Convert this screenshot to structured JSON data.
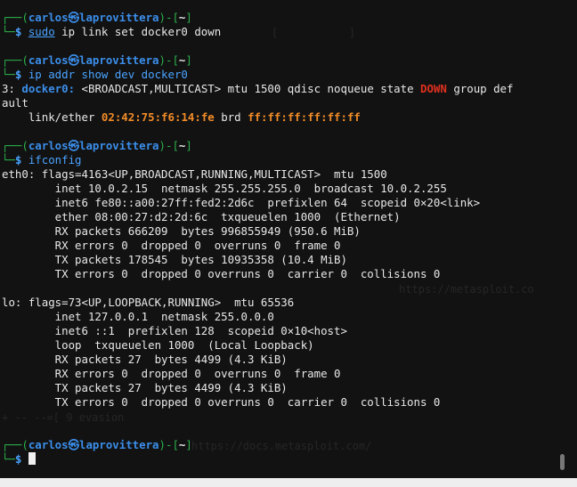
{
  "prompt": {
    "user": "carlos",
    "at": "㉿",
    "host": "laprovittera",
    "dir": "~"
  },
  "blocks": [
    {
      "command": "sudo ip link set docker0 down",
      "cmd_word": "sudo",
      "rest": "ip link set docker0 down"
    },
    {
      "command": "ip addr show dev docker0"
    },
    {
      "command": "ifconfig"
    }
  ],
  "ip_output": {
    "idx": "3:",
    "iface": "docker0:",
    "flags": "<BROADCAST,MULTICAST> mtu 1500 qdisc noqueue state",
    "state": "DOWN",
    "after_state": "group def",
    "wrap": "ault",
    "link_prefix": "link/ether",
    "mac": "02:42:75:f6:14:fe",
    "brd": "brd",
    "brd_mac": "ff:ff:ff:ff:ff:ff"
  },
  "ifconfig_lines": [
    "eth0: flags=4163<UP,BROADCAST,RUNNING,MULTICAST>  mtu 1500",
    "        inet 10.0.2.15  netmask 255.255.255.0  broadcast 10.0.2.255",
    "        inet6 fe80::a00:27ff:fed2:2d6c  prefixlen 64  scopeid 0×20<link>",
    "        ether 08:00:27:d2:2d:6c  txqueuelen 1000  (Ethernet)",
    "        RX packets 666209  bytes 996855949 (950.6 MiB)",
    "        RX errors 0  dropped 0  overruns 0  frame 0",
    "        TX packets 178545  bytes 10935358 (10.4 MiB)",
    "        TX errors 0  dropped 0 overruns 0  carrier 0  collisions 0",
    "",
    "lo: flags=73<UP,LOOPBACK,RUNNING>  mtu 65536",
    "        inet 127.0.0.1  netmask 255.0.0.0",
    "        inet6 ::1  prefixlen 128  scopeid 0×10<host>",
    "        loop  txqueuelen 1000  (Local Loopback)",
    "        RX packets 27  bytes 4499 (4.3 KiB)",
    "        RX errors 0  dropped 0  overruns 0  frame 0",
    "        TX packets 27  bytes 4499 (4.3 KiB)",
    "        TX errors 0  dropped 0 overruns 0  carrier 0  collisions 0"
  ],
  "background": {
    "url1": "https://metasploit.co",
    "url2": "https://docs.metasploit.com/",
    "evasion": "9 evasion"
  },
  "colors": {
    "background": "#121212",
    "prompt_frame": "#2bb24c",
    "user_host": "#3b8eea",
    "mac": "#f28c28",
    "state_down": "#e0301e"
  }
}
